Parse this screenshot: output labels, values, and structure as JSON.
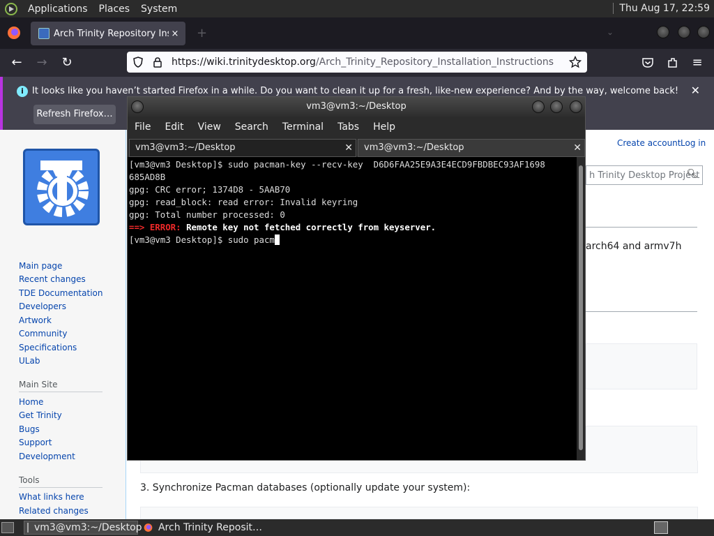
{
  "top_panel": {
    "menu": [
      "Applications",
      "Places",
      "System"
    ],
    "clock": "Thu Aug 17, 22:59"
  },
  "firefox": {
    "tab_title": "Arch Trinity Repository Insta",
    "tab_close": "×",
    "new_tab": "+",
    "url_host": "https://wiki.trinitydesktop.org",
    "url_path": "/Arch_Trinity_Repository_Installation_Instructions",
    "notification": {
      "message": "It looks like you haven’t started Firefox in a while. Do you want to clean it up for a fresh, like-new experience? And by the way, welcome back!",
      "button": "Refresh Firefox…"
    }
  },
  "wiki": {
    "account": [
      "Create account",
      "Log in"
    ],
    "search_placeholder": "h Trinity Desktop Project",
    "nav_links": [
      "Main page",
      "Recent changes",
      "TDE Documentation",
      "Developers",
      "Artwork",
      "Community",
      "Specifications",
      "ULab"
    ],
    "main_site_heading": "Main Site",
    "main_site_links": [
      "Home",
      "Get Trinity",
      "Bugs",
      "Support",
      "Development"
    ],
    "tools_heading": "Tools",
    "tools_links": [
      "What links here",
      "Related changes"
    ],
    "snippet_arch": "arch64 and armv7h",
    "step3": "3. Synchronize Pacman databases (optionally update your system):"
  },
  "terminal": {
    "title": "vm3@vm3:~/Desktop",
    "menu": [
      "File",
      "Edit",
      "View",
      "Search",
      "Terminal",
      "Tabs",
      "Help"
    ],
    "tabs": [
      "vm3@vm3:~/Desktop",
      "vm3@vm3:~/Desktop"
    ],
    "lines": [
      "[vm3@vm3 Desktop]$ sudo pacman-key --recv-key  D6D6FAA25E9A3E4ECD9FBDBEC93AF1698",
      "685AD8B",
      "gpg: CRC error; 1374D8 - 5AAB70",
      "gpg: read_block: read error: Invalid keyring",
      "gpg: Total number processed: 0"
    ],
    "error_prefix": "==> ERROR:",
    "error_message": " Remote key not fetched correctly from keyserver.",
    "prompt_line": "[vm3@vm3 Desktop]$ sudo pacm"
  },
  "taskbar": {
    "tasks": [
      "vm3@vm3:~/Desktop",
      "Arch Trinity Reposit…"
    ]
  }
}
